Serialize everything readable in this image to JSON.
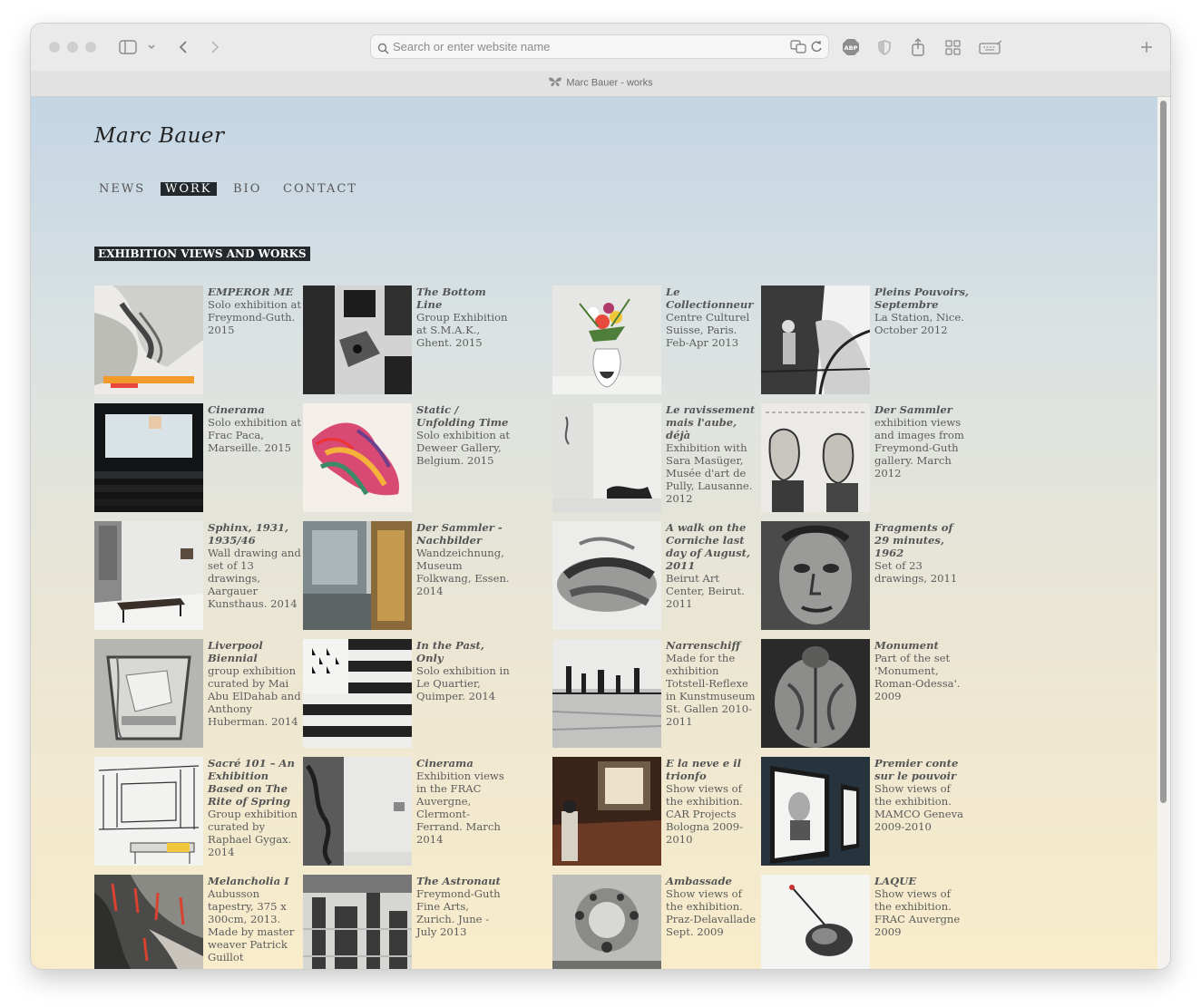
{
  "browser": {
    "address_placeholder": "Search or enter website name",
    "tab_title": "Marc Bauer - works",
    "abp_label": "ABP"
  },
  "site": {
    "logo": "Marc Bauer",
    "nav": [
      {
        "label": "NEWS",
        "active": false
      },
      {
        "label": "WORK",
        "active": true
      },
      {
        "label": "BIO",
        "active": false
      },
      {
        "label": "CONTACT",
        "active": false
      }
    ],
    "section_title": "EXHIBITION VIEWS AND WORKS"
  },
  "works": [
    {
      "title": "EMPEROR ME",
      "desc": "Solo exhibition at Freymond-Guth. 2015",
      "img": "drawing-fabric-with-orange"
    },
    {
      "title": "The Bottom Line",
      "desc": "Group Exhibition at S.M.A.K., Ghent. 2015",
      "img": "gallery-dark-panels"
    },
    {
      "title": "Le Collectionneur",
      "desc": "Centre Culturel Suisse, Paris. Feb-Apr 2013",
      "img": "flower-vase"
    },
    {
      "title": "Pleins Pouvoirs, Septembre",
      "desc": "La Station, Nice. October 2012",
      "img": "figure-drawing-bw"
    },
    {
      "title": "Cinerama",
      "desc": "Solo exhibition at Frac Paca, Marseille. 2015",
      "img": "cinema-screen"
    },
    {
      "title": "Static / Unfolding Time",
      "desc": "Solo exhibition at Deweer Gallery, Belgium. 2015",
      "img": "colorful-flower-drawing"
    },
    {
      "title": "Le ravissement mais l'aube, déjà",
      "desc": "Exhibition with Sara Masüger, Musée d'art de Pully, Lausanne. 2012",
      "img": "white-room-sculpture"
    },
    {
      "title": "Der Sammler",
      "desc": "exhibition views and images from Freymond-Guth gallery. March 2012",
      "img": "caricature-drawing"
    },
    {
      "title": "Sphinx, 1931, 1935/46",
      "desc": "Wall drawing and set of 13 drawings, Aargauer Kunsthaus. 2014",
      "img": "gallery-bench"
    },
    {
      "title": "Der Sammler - Nachbilder",
      "desc": "Wandzeichnung, Museum Folkwang, Essen. 2014",
      "img": "museum-interior"
    },
    {
      "title": "A walk on the Corniche last day of August, 2011",
      "desc": "Beirut Art Center, Beirut. 2011",
      "img": "smudged-charcoal"
    },
    {
      "title": "Fragments of 29 minutes, 1962",
      "desc": "Set of 23 drawings, 2011",
      "img": "face-portrait"
    },
    {
      "title": "Liverpool Biennial",
      "desc": "group exhibition curated by Mai Abu ElDahab and Anthony Huberman. 2014",
      "img": "glass-with-ice"
    },
    {
      "title": "In the Past, Only",
      "desc": "Solo exhibition in Le Quartier, Quimper. 2014",
      "img": "breton-flag"
    },
    {
      "title": "Narrenschiff",
      "desc": "Made for the exhibition Totstell-Reflexe in Kunstmuseum St. Gallen 2010-2011",
      "img": "figures-in-water"
    },
    {
      "title": "Monument",
      "desc": "Part of the set 'Monument, Roman-Odessa'. 2009",
      "img": "muscular-back"
    },
    {
      "title": "Sacré 101 – An Exhibition Based on The Rite of Spring",
      "desc": "Group exhibition curated by Raphael Gygax. 2014",
      "img": "sketch-interior"
    },
    {
      "title": "Cinerama",
      "desc": "Exhibition views in the FRAC Auvergne, Clermont-Ferrand. March 2014",
      "img": "gallery-wall-drawing"
    },
    {
      "title": "E la neve e il trionfo",
      "desc": "Show views of the exhibition. CAR Projects Bologna 2009-2010",
      "img": "brick-room-light"
    },
    {
      "title": "Premier conte sur le pouvoir",
      "desc": "Show views of the exhibition. MAMCO Geneva 2009-2010",
      "img": "framed-portraits"
    },
    {
      "title": "Melancholia I",
      "desc": "Aubusson tapestry, 375 x 300cm, 2013. Made by master weaver Patrick Guillot",
      "img": "tapestry-red-strokes"
    },
    {
      "title": "The Astronaut",
      "desc": "Freymond-Guth Fine Arts, Zurich. June - July 2013",
      "img": "machine-drawing"
    },
    {
      "title": "Ambassade",
      "desc": "Show views of the exhibition. Praz-Delavallade Sept. 2009",
      "img": "chandelier"
    },
    {
      "title": "LAQUE",
      "desc": "Show views of the exhibition. FRAC Auvergne 2009",
      "img": "small-object-drawing"
    }
  ]
}
